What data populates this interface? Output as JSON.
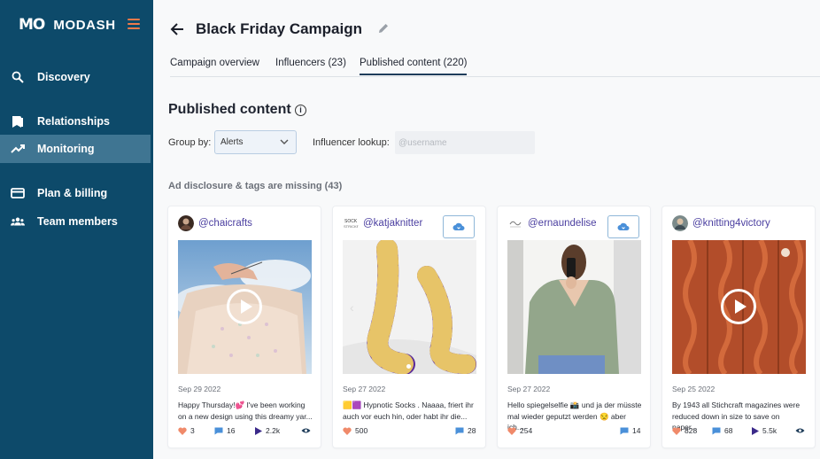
{
  "brand": {
    "mark": "MO",
    "name": "MODASH"
  },
  "colors": {
    "sidebar": "#0d4a6a",
    "sidebar_active": "#3f7592",
    "accent": "#f07a4a",
    "handle": "#4b3fa0"
  },
  "sidebar": {
    "items": [
      {
        "label": "Discovery",
        "icon": "search-icon"
      },
      {
        "label": "Relationships",
        "icon": "bookmark-icon"
      },
      {
        "label": "Monitoring",
        "icon": "trending-icon",
        "active": true
      },
      {
        "label": "Plan & billing",
        "icon": "credit-card-icon"
      },
      {
        "label": "Team members",
        "icon": "team-icon"
      }
    ]
  },
  "header": {
    "title": "Black Friday Campaign",
    "tabs": [
      {
        "label": "Campaign overview"
      },
      {
        "label": "Influencers (23)"
      },
      {
        "label": "Published content (220)",
        "active": true
      }
    ]
  },
  "content": {
    "section_title": "Published content",
    "group_by_label": "Group by:",
    "group_by_value": "Alerts",
    "lookup_label": "Influencer lookup:",
    "lookup_placeholder": "@username",
    "group_heading": "Ad disclosure & tags are missing (43)"
  },
  "cards": [
    {
      "handle": "@chaicrafts",
      "date": "Sep 29 2022",
      "caption_1": "Happy Thursday!💕 I've been working",
      "caption_2": "on a new design using this dreamy yar...",
      "likes": "3",
      "comments": "16",
      "views": "2.2k"
    },
    {
      "handle": "@katjaknitter",
      "date": "Sep 27 2022",
      "caption_1": "🟨🟪 Hypnotic Socks . Naaaa, friert ihr",
      "caption_2": "auch vor euch hin, oder habt ihr die...",
      "likes": "500",
      "comments": "28"
    },
    {
      "handle": "@ernaundelise",
      "date": "Sep 27 2022",
      "caption_1": "Hello spiegelselfie 📸 und ja der müsste",
      "caption_2": "mal wieder geputzt werden 😒 aber ich...",
      "likes": "254",
      "comments": "14"
    },
    {
      "handle": "@knitting4victory",
      "date": "Sep 25 2022",
      "caption_1": "By 1943 all Stichcraft magazines were",
      "caption_2": "reduced down in size to save on paper...",
      "likes": "828",
      "comments": "68",
      "views": "5.5k"
    }
  ]
}
